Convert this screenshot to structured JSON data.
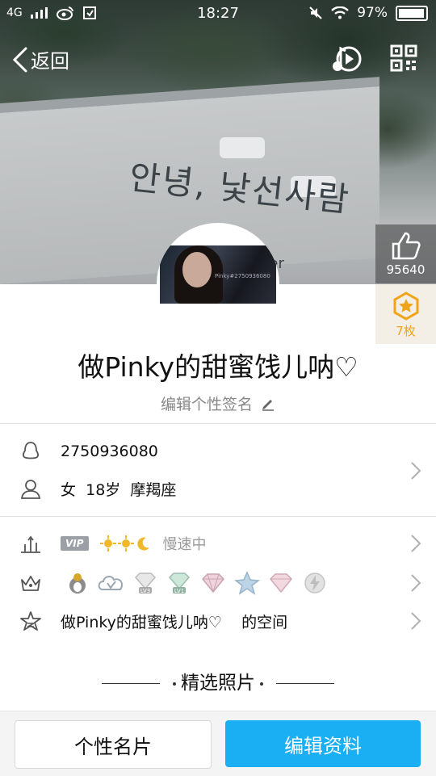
{
  "status_bar": {
    "network": "4G",
    "time": "18:27",
    "battery": "97%"
  },
  "nav": {
    "back_label": "返回"
  },
  "hero": {
    "wall_sign": "안녕, 낯선사람",
    "wall_sign_suffix": "ger"
  },
  "likes": {
    "count": "95640"
  },
  "medals": {
    "count": "7枚"
  },
  "avatar": {
    "watermark": "Pinky#2750936080"
  },
  "profile": {
    "nickname": "做Pinky的甜蜜饯儿呐♡",
    "signature_placeholder": "编辑个性签名",
    "qq_number": "2750936080",
    "gender": "女",
    "age": "18岁",
    "zodiac": "摩羯座"
  },
  "vip": {
    "badge": "VIP",
    "status": "慢速中"
  },
  "space": {
    "text": "做Pinky的甜蜜饯儿呐♡    的空间"
  },
  "badges": [
    {
      "icon": "qq-penguin-badge-icon"
    },
    {
      "icon": "svip-badge-icon"
    },
    {
      "icon": "diamond-lv3-badge-icon",
      "label": "LV3"
    },
    {
      "icon": "diamond-lv1-badge-icon",
      "label": "LV1"
    },
    {
      "icon": "pink-diamond-badge-icon"
    },
    {
      "icon": "star-badge-icon"
    },
    {
      "icon": "pink-diamond-2-badge-icon"
    },
    {
      "icon": "lightning-badge-icon"
    }
  ],
  "section": {
    "title": "精选照片"
  },
  "buttons": {
    "card": "个性名片",
    "edit": "编辑资料"
  },
  "colors": {
    "accent": "#1aaff2",
    "medal": "#f0a419"
  }
}
